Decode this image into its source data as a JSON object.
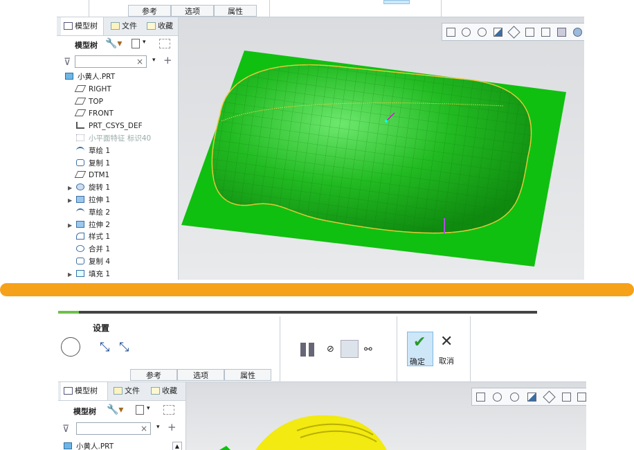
{
  "top_panel": {
    "tabs": [
      "参考",
      "选项",
      "属性"
    ],
    "tree_tabs": [
      "模型树",
      "文件",
      "收藏"
    ],
    "toolbar_label": "模型树",
    "filter_placeholder": "",
    "tree": [
      {
        "label": "小黄人.PRT",
        "icon": "part-icon",
        "expand": false,
        "dim": false
      },
      {
        "label": "RIGHT",
        "icon": "datum-plane-icon",
        "expand": false,
        "dim": false
      },
      {
        "label": "TOP",
        "icon": "datum-plane-icon",
        "expand": false,
        "dim": false
      },
      {
        "label": "FRONT",
        "icon": "datum-plane-icon",
        "expand": false,
        "dim": false
      },
      {
        "label": "PRT_CSYS_DEF",
        "icon": "csys-icon",
        "expand": false,
        "dim": false
      },
      {
        "label": "小平面特征 标识40",
        "icon": "facet-icon",
        "expand": false,
        "dim": true
      },
      {
        "label": "草绘 1",
        "icon": "sketch-icon",
        "expand": false,
        "dim": false
      },
      {
        "label": "复制 1",
        "icon": "copy-icon",
        "expand": false,
        "dim": false
      },
      {
        "label": "DTM1",
        "icon": "datum-plane-icon",
        "expand": false,
        "dim": false
      },
      {
        "label": "旋转 1",
        "icon": "revolve-icon",
        "expand": true,
        "dim": false
      },
      {
        "label": "拉伸 1",
        "icon": "extrude-icon",
        "expand": true,
        "dim": false
      },
      {
        "label": "草绘 2",
        "icon": "sketch-icon",
        "expand": false,
        "dim": false
      },
      {
        "label": "拉伸 2",
        "icon": "extrude-icon",
        "expand": true,
        "dim": false
      },
      {
        "label": "样式 1",
        "icon": "style-icon",
        "expand": false,
        "dim": false
      },
      {
        "label": "合并 1",
        "icon": "merge-icon",
        "expand": false,
        "dim": false
      },
      {
        "label": "复制 4",
        "icon": "copy-icon",
        "expand": false,
        "dim": false
      },
      {
        "label": "填充 1",
        "icon": "fill-icon",
        "expand": true,
        "dim": false
      }
    ]
  },
  "bottom_panel": {
    "settings_label": "设置",
    "tabs": [
      "参考",
      "选项",
      "属性"
    ],
    "ok_label": "确定",
    "cancel_label": "取消",
    "tree_tabs": [
      "模型树",
      "文件",
      "收藏"
    ],
    "toolbar_label": "模型树",
    "tree_first": "小黄人.PRT"
  },
  "colors": {
    "accent": "#f5a11a",
    "surface_green": "#1fbf1f",
    "plane_green": "#10c010",
    "yellow": "#f2ea10"
  }
}
